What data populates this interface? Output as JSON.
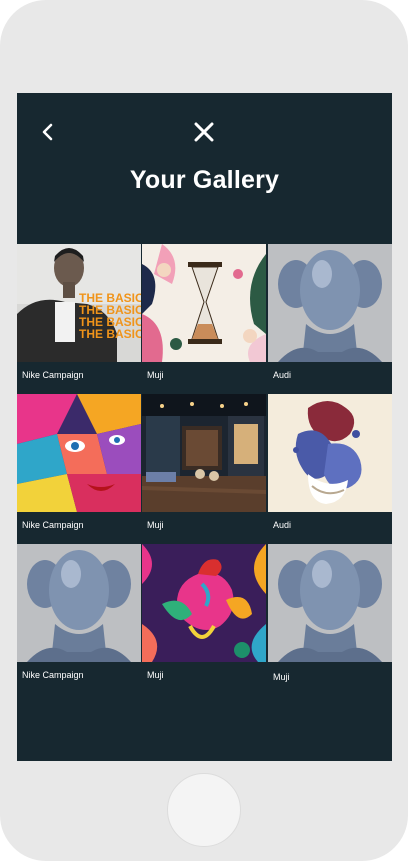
{
  "header": {
    "title": "Your Gallery",
    "back_icon": "chevron-left-icon",
    "close_icon": "close-icon"
  },
  "gallery": {
    "items": [
      {
        "caption": "Nike Campaign",
        "image": "man-portrait-the-basics-poster"
      },
      {
        "caption": "Muji",
        "image": "hourglass-illustration"
      },
      {
        "caption": "Audi",
        "image": "chrome-head-sculpture"
      },
      {
        "caption": "Nike Campaign",
        "image": "colorful-face-painting"
      },
      {
        "caption": "Muji",
        "image": "lounge-interior"
      },
      {
        "caption": "Audi",
        "image": "abstract-fabric-sculpture"
      },
      {
        "caption": "Nike Campaign",
        "image": "chrome-head-sculpture"
      },
      {
        "caption": "Muji",
        "image": "rooster-floral-illustration"
      },
      {
        "caption": "Muji",
        "image": "chrome-head-sculpture"
      }
    ],
    "poster_text": "THE BASICS"
  },
  "colors": {
    "screen_background": "#172830",
    "phone_frame": "#e8e8e8",
    "text": "#ffffff"
  }
}
